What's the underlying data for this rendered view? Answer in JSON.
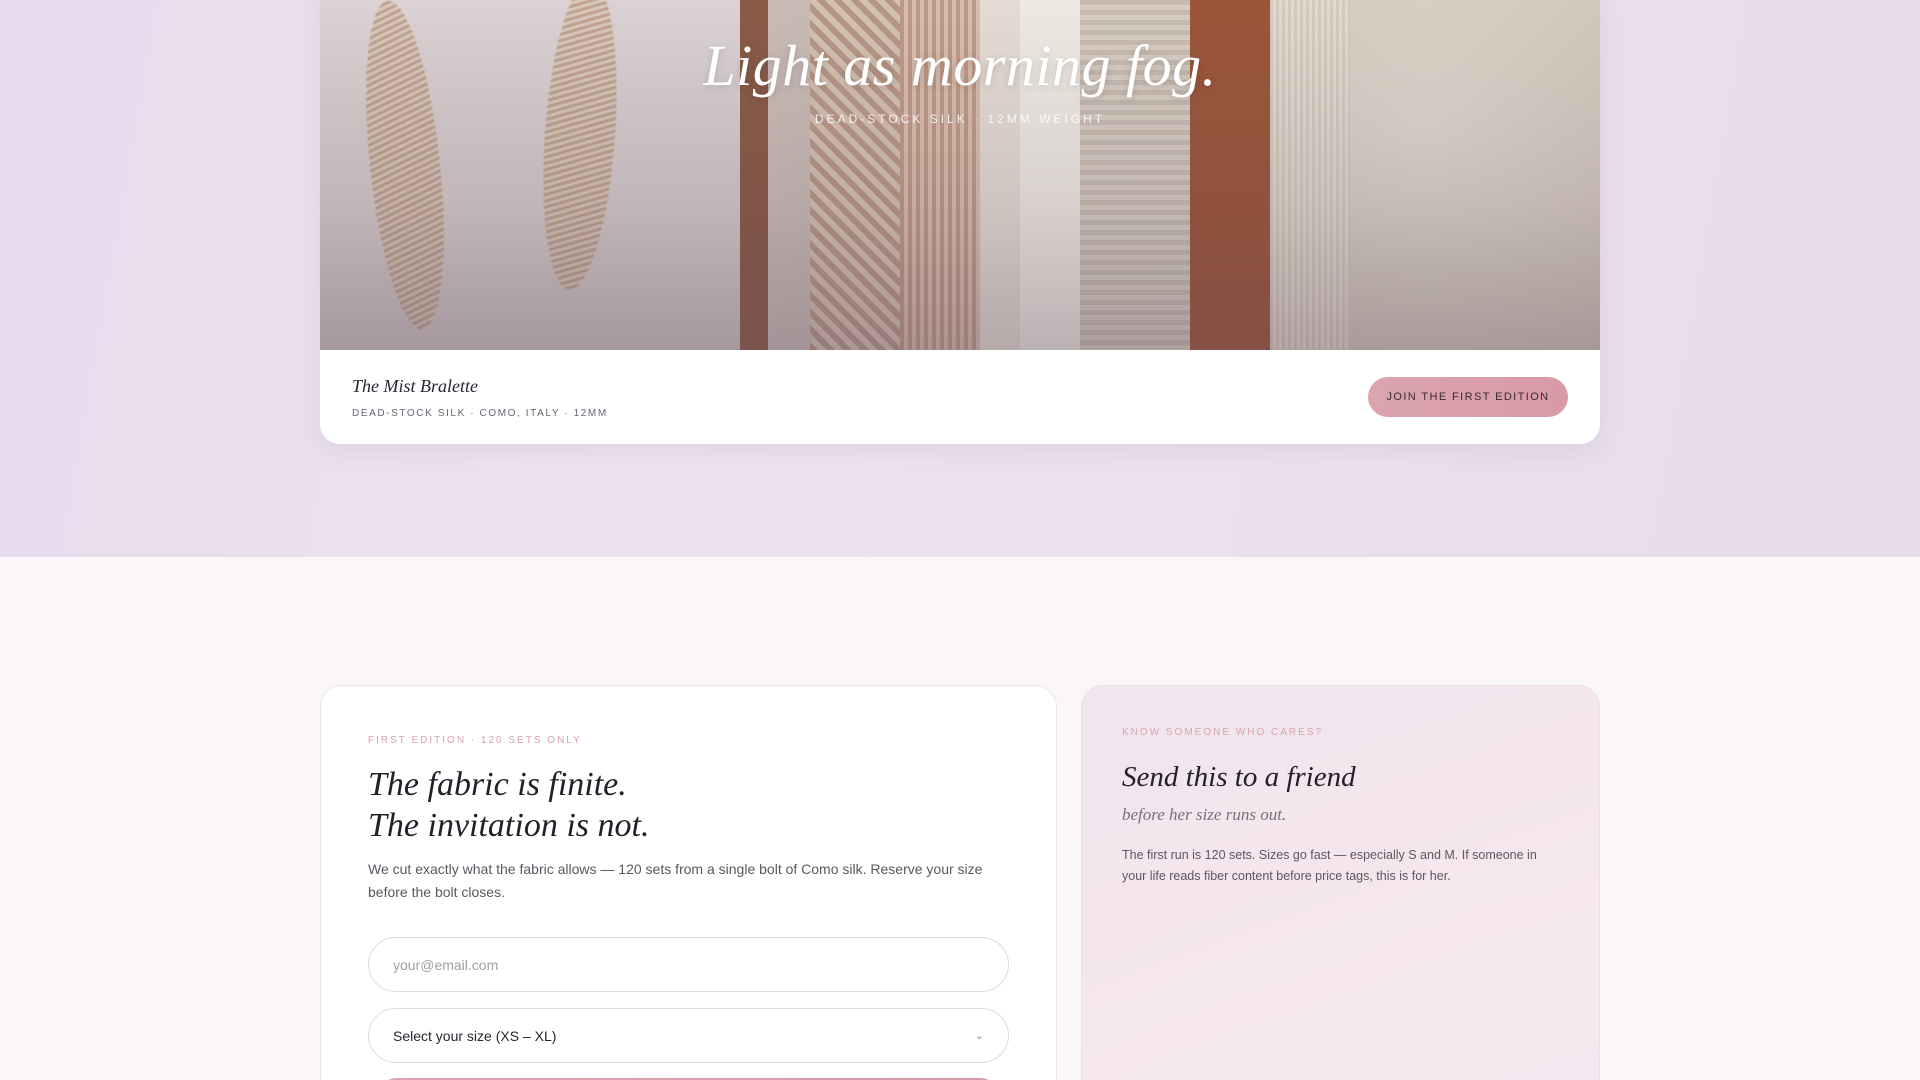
{
  "hero": {
    "title": "Light as morning fog.",
    "subtitle": "DEAD-STOCK SILK · 12MM WEIGHT",
    "product_name": "The Mist Bralette",
    "product_meta": "DEAD-STOCK SILK · COMO, ITALY · 12MM",
    "join_label": "JOIN THE FIRST EDITION"
  },
  "invite": {
    "eyebrow": "FIRST EDITION · 120 SETS ONLY",
    "title_line1": "The fabric is finite.",
    "title_line2": "The invitation is not.",
    "body": "We cut exactly what the fabric allows — 120 sets from a single bolt of Como silk. Reserve your size before the bolt closes.",
    "email_placeholder": "your@email.com",
    "size_label": "Select your size (XS – XL)"
  },
  "friend": {
    "eyebrow": "KNOW SOMEONE WHO CARES?",
    "title": "Send this to a friend",
    "subtitle": "before her size runs out.",
    "body": "The first run is 120 sets. Sizes go fast — especially S and M. If someone in your life reads fiber content before price tags, this is for her."
  },
  "colors": {
    "accent": "#dba4ae",
    "band": "#e9dfee",
    "page": "#fbf7f9"
  },
  "icons": {
    "select_chevron": "chevron-down-icon"
  }
}
